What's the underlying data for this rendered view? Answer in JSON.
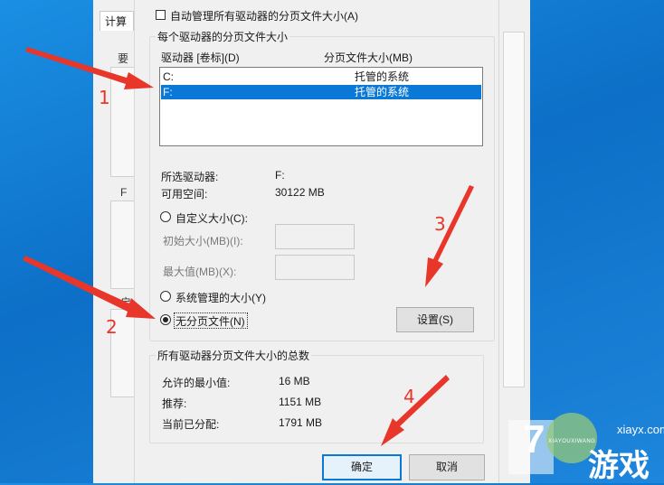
{
  "background_window": {
    "tab_label": "计算",
    "chars": [
      "要",
      "F",
      "启"
    ]
  },
  "dialog": {
    "auto_manage_label": "自动管理所有驱动器的分页文件大小(A)",
    "per_drive_group_title": "每个驱动器的分页文件大小",
    "list_headers": {
      "drive": "驱动器 [卷标](D)",
      "size": "分页文件大小(MB)"
    },
    "drives": [
      {
        "letter": "C:",
        "size": "托管的系统",
        "selected": false
      },
      {
        "letter": "F:",
        "size": "托管的系统",
        "selected": true
      }
    ],
    "selected_drive_label": "所选驱动器:",
    "selected_drive_value": "F:",
    "free_space_label": "可用空间:",
    "free_space_value": "30122 MB",
    "custom_size_label": "自定义大小(C):",
    "initial_size_label": "初始大小(MB)(I):",
    "max_size_label": "最大值(MB)(X):",
    "system_managed_label": "系统管理的大小(Y)",
    "no_paging_label": "无分页文件(N)",
    "set_button": "设置(S)",
    "totals_group_title": "所有驱动器分页文件大小的总数",
    "min_allowed_label": "允许的最小值:",
    "min_allowed_value": "16 MB",
    "recommended_label": "推荐:",
    "recommended_value": "1151 MB",
    "currently_allocated_label": "当前已分配:",
    "currently_allocated_value": "1791 MB",
    "ok_button": "确定",
    "cancel_button": "取消"
  },
  "annotations": {
    "numbers": [
      "1",
      "2",
      "3",
      "4"
    ],
    "arrow_color": "#e8362b"
  },
  "watermark": {
    "big_text": "游戏",
    "small_text": "xiayx.com",
    "tiny_text": "XIAYOUXIWANG",
    "logo_char": "7"
  },
  "colors": {
    "selection": "#0a78d7",
    "desktop": "#0d6fc7"
  }
}
